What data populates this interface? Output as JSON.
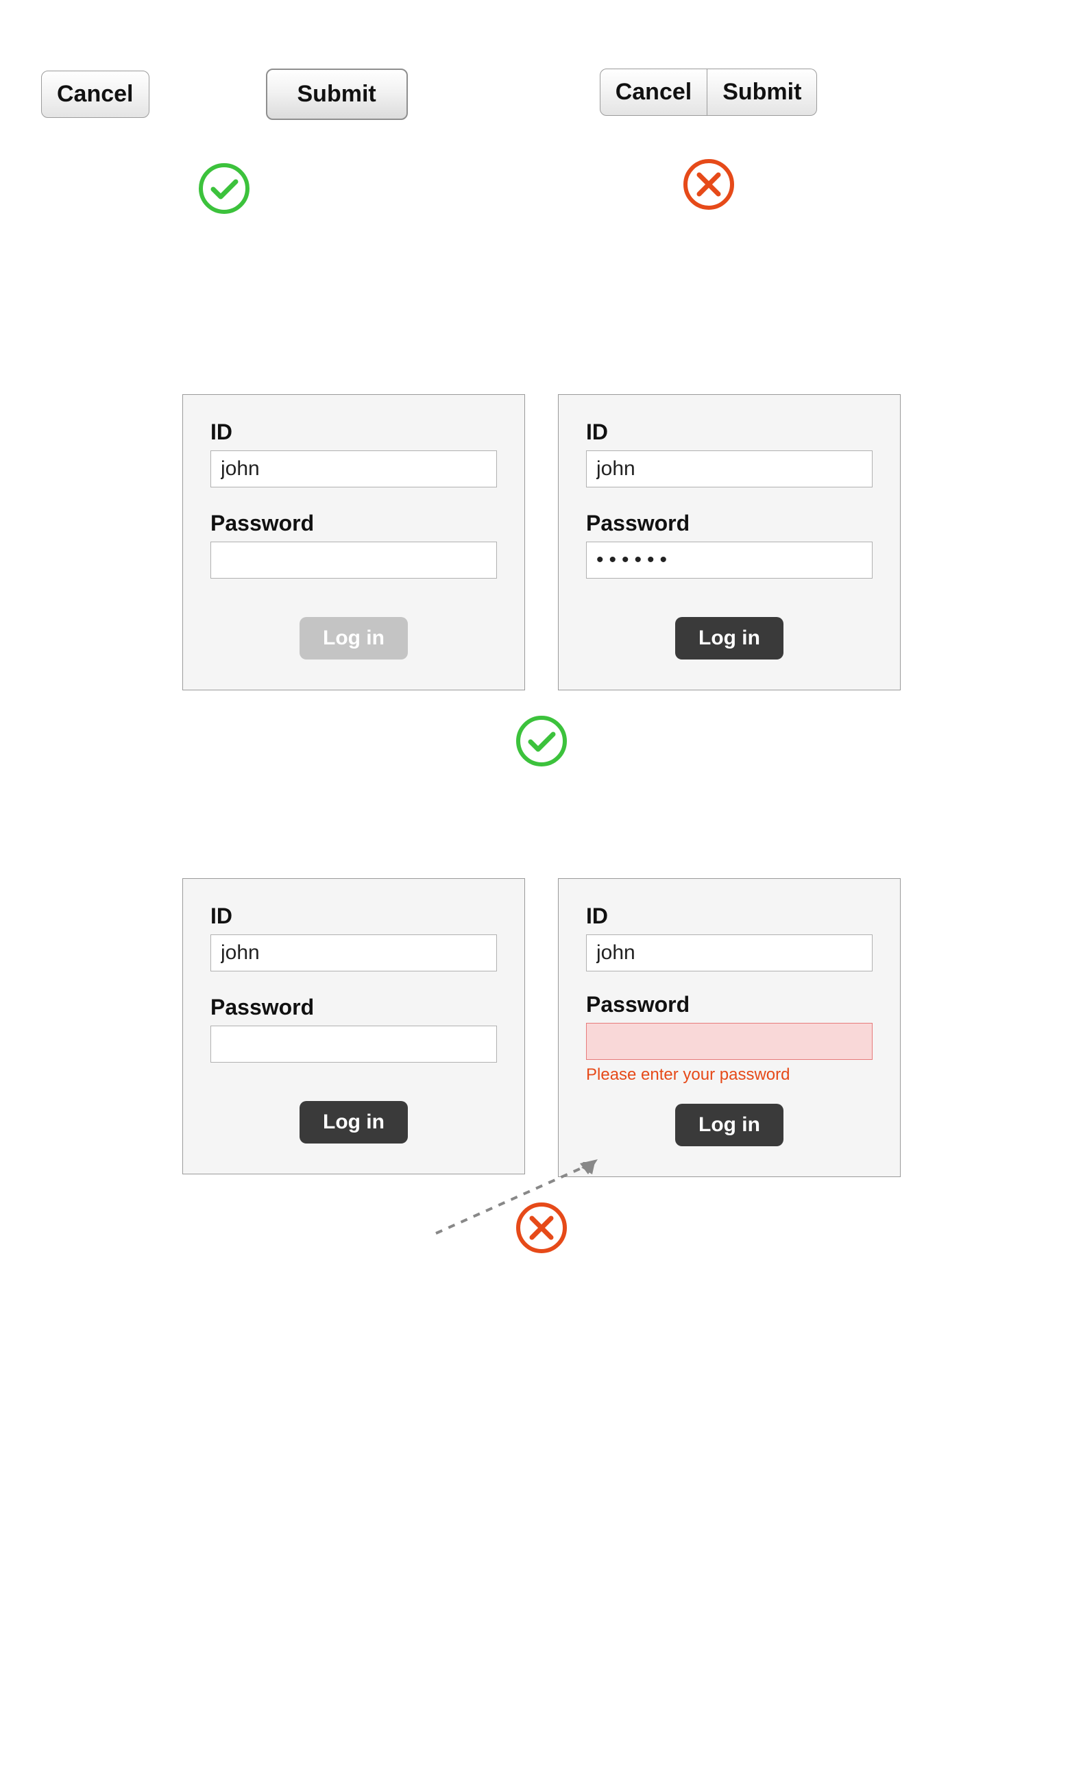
{
  "buttons": {
    "cancel": "Cancel",
    "submit": "Submit"
  },
  "login": {
    "id_label": "ID",
    "id_value": "john",
    "password_label": "Password",
    "password_masked": "••••••",
    "password_error": "Please enter your password",
    "login_label": "Log in"
  },
  "colors": {
    "good": "#3cc23c",
    "bad": "#e64a19",
    "panel_bg": "#f5f5f5",
    "panel_border": "#9a9a9a",
    "btn_dark": "#3a3a3a",
    "btn_disabled": "#c4c4c4",
    "error_bg": "#f9d8d8",
    "error_border": "#e77a7a",
    "arrow": "#888888"
  }
}
